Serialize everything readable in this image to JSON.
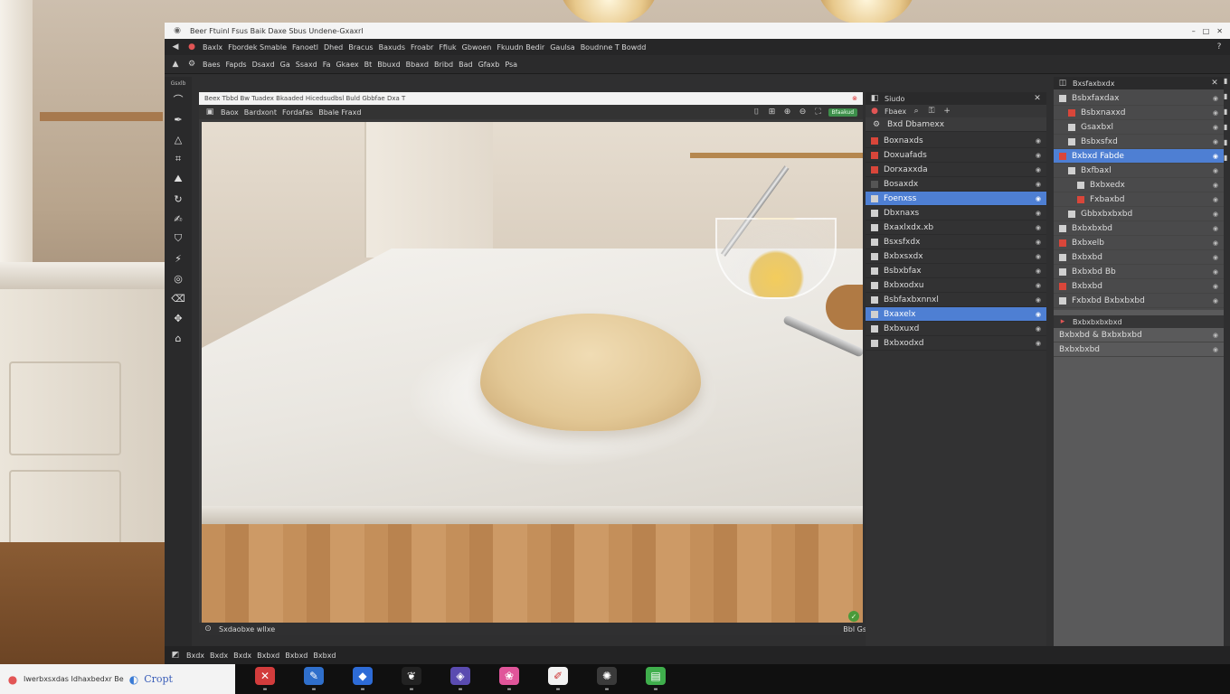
{
  "window": {
    "title": "Beer Ftuinl Fsus Baik Daxe Sbus Undene-Gxaxrl",
    "controls": [
      "–",
      "□",
      "✕"
    ]
  },
  "menubar": [
    "Baxlx",
    "Fbordek Smable",
    "Fanoetl",
    "Dhed",
    "Bracus",
    "Baxuds",
    "Froabr",
    "Ffiuk",
    "Gbwoen",
    "Fkuudn Bedir",
    "Gaulsa",
    "Boudnne T Bowdd"
  ],
  "toolbar": [
    "Baes",
    "Fapds",
    "Dsaxd",
    "Ga",
    "Ssaxd",
    "Fa",
    "Gkaex",
    "Bt",
    "Bbuxd",
    "Bbaxd",
    "Bribd",
    "Bad",
    "Gfaxb",
    "Psa"
  ],
  "tools_label": "Gsxlb",
  "document": {
    "url": "Beex Tbbd Bw Tuadex Bkaaded Hicedsudbsl Buld Gbbfae Dxa T",
    "header_items": [
      "Baox",
      "Bardxont",
      "Fordafas",
      "Bbale Fraxd"
    ],
    "zoom_badge": "Bfaakud",
    "footer_left": "Sxdaobxe wllxe",
    "footer_right": "Bbl Gs"
  },
  "layers": {
    "title": "Siudo",
    "tab": "Fbaex",
    "group": "Bxd Dbamexx",
    "items": [
      {
        "label": "Boxnaxds",
        "icon": "red",
        "selected": false
      },
      {
        "label": "Doxuafads",
        "icon": "red",
        "selected": false
      },
      {
        "label": "Dorxaxxda",
        "icon": "red",
        "selected": false
      },
      {
        "label": "Bosaxdx",
        "icon": "dark",
        "selected": false
      },
      {
        "label": "Foenxss",
        "icon": "light",
        "selected": true
      },
      {
        "label": "Dbxnaxs",
        "icon": "light",
        "selected": false
      },
      {
        "label": "Bxaxlxdx.xb",
        "icon": "light",
        "selected": false
      },
      {
        "label": "Bsxsfxdx",
        "icon": "light",
        "selected": false
      },
      {
        "label": "Bxbxsxdx",
        "icon": "light",
        "selected": false
      },
      {
        "label": "Bsbxbfax",
        "icon": "light",
        "selected": false
      },
      {
        "label": "Bxbxodxu",
        "icon": "light",
        "selected": false
      },
      {
        "label": "Bsbfaxbxnnxl",
        "icon": "light",
        "selected": false
      },
      {
        "label": "Bxaxelx",
        "icon": "light",
        "selected": true
      },
      {
        "label": "Bxbxuxd",
        "icon": "light",
        "selected": false
      },
      {
        "label": "Bxbxodxd",
        "icon": "light",
        "selected": false
      }
    ]
  },
  "properties": {
    "title": "Bxsfaxbxdx",
    "items": [
      {
        "label": "Bsbxfaxdax",
        "indent": 0,
        "selected": false
      },
      {
        "label": "Bsbxnaxxd",
        "indent": 1,
        "selected": false
      },
      {
        "label": "Gsaxbxl",
        "indent": 1,
        "selected": false
      },
      {
        "label": "Bsbxsfxd",
        "indent": 1,
        "selected": false
      },
      {
        "label": "Bxbxd Fabde",
        "indent": 0,
        "selected": true
      },
      {
        "label": "Bxfbaxl",
        "indent": 1,
        "selected": false
      },
      {
        "label": "Bxbxedx",
        "indent": 2,
        "selected": false
      },
      {
        "label": "Fxbaxbd",
        "indent": 3,
        "selected": false
      },
      {
        "label": "Gbbxbxbxbd",
        "indent": 1,
        "selected": false
      },
      {
        "label": "Bxbxbxbd",
        "indent": 0,
        "selected": false
      },
      {
        "label": "Bxbxelb",
        "indent": 0,
        "selected": false
      },
      {
        "label": "Bxbxbd",
        "indent": 0,
        "selected": false
      },
      {
        "label": "Bxbxbd Bb",
        "indent": 0,
        "selected": false
      },
      {
        "label": "Bxbxbd",
        "indent": 0,
        "selected": false
      },
      {
        "label": "Fxbxbd Bxbxbxbd",
        "indent": 0,
        "selected": false
      }
    ],
    "section2_title": "Bxbxbxbxbxd",
    "section2_items": [
      "Bxbxbd & Bxbxbxbd",
      "Bxbxbxbd"
    ]
  },
  "appfoot": [
    "Bxdx",
    "Bxdx",
    "Bxdx",
    "Bxbxd",
    "Bxbxd",
    "Bxbxd"
  ],
  "taskbar": {
    "search_text": "Iwerbxsxdas Idhaxbedxr Be",
    "brand": "Cropt",
    "apps": [
      {
        "color": "#d23c3c",
        "glyph": "✕"
      },
      {
        "color": "#2f6fcb",
        "glyph": "✎"
      },
      {
        "color": "#2d6bd6",
        "glyph": "◆"
      },
      {
        "color": "#222222",
        "glyph": "❦"
      },
      {
        "color": "#5a4bb0",
        "glyph": "◈"
      },
      {
        "color": "#e0559a",
        "glyph": "❀"
      },
      {
        "color": "#f2f2f2",
        "glyph": "✐"
      },
      {
        "color": "#3a3a3a",
        "glyph": "✺"
      },
      {
        "color": "#3fae4c",
        "glyph": "▤"
      }
    ]
  }
}
